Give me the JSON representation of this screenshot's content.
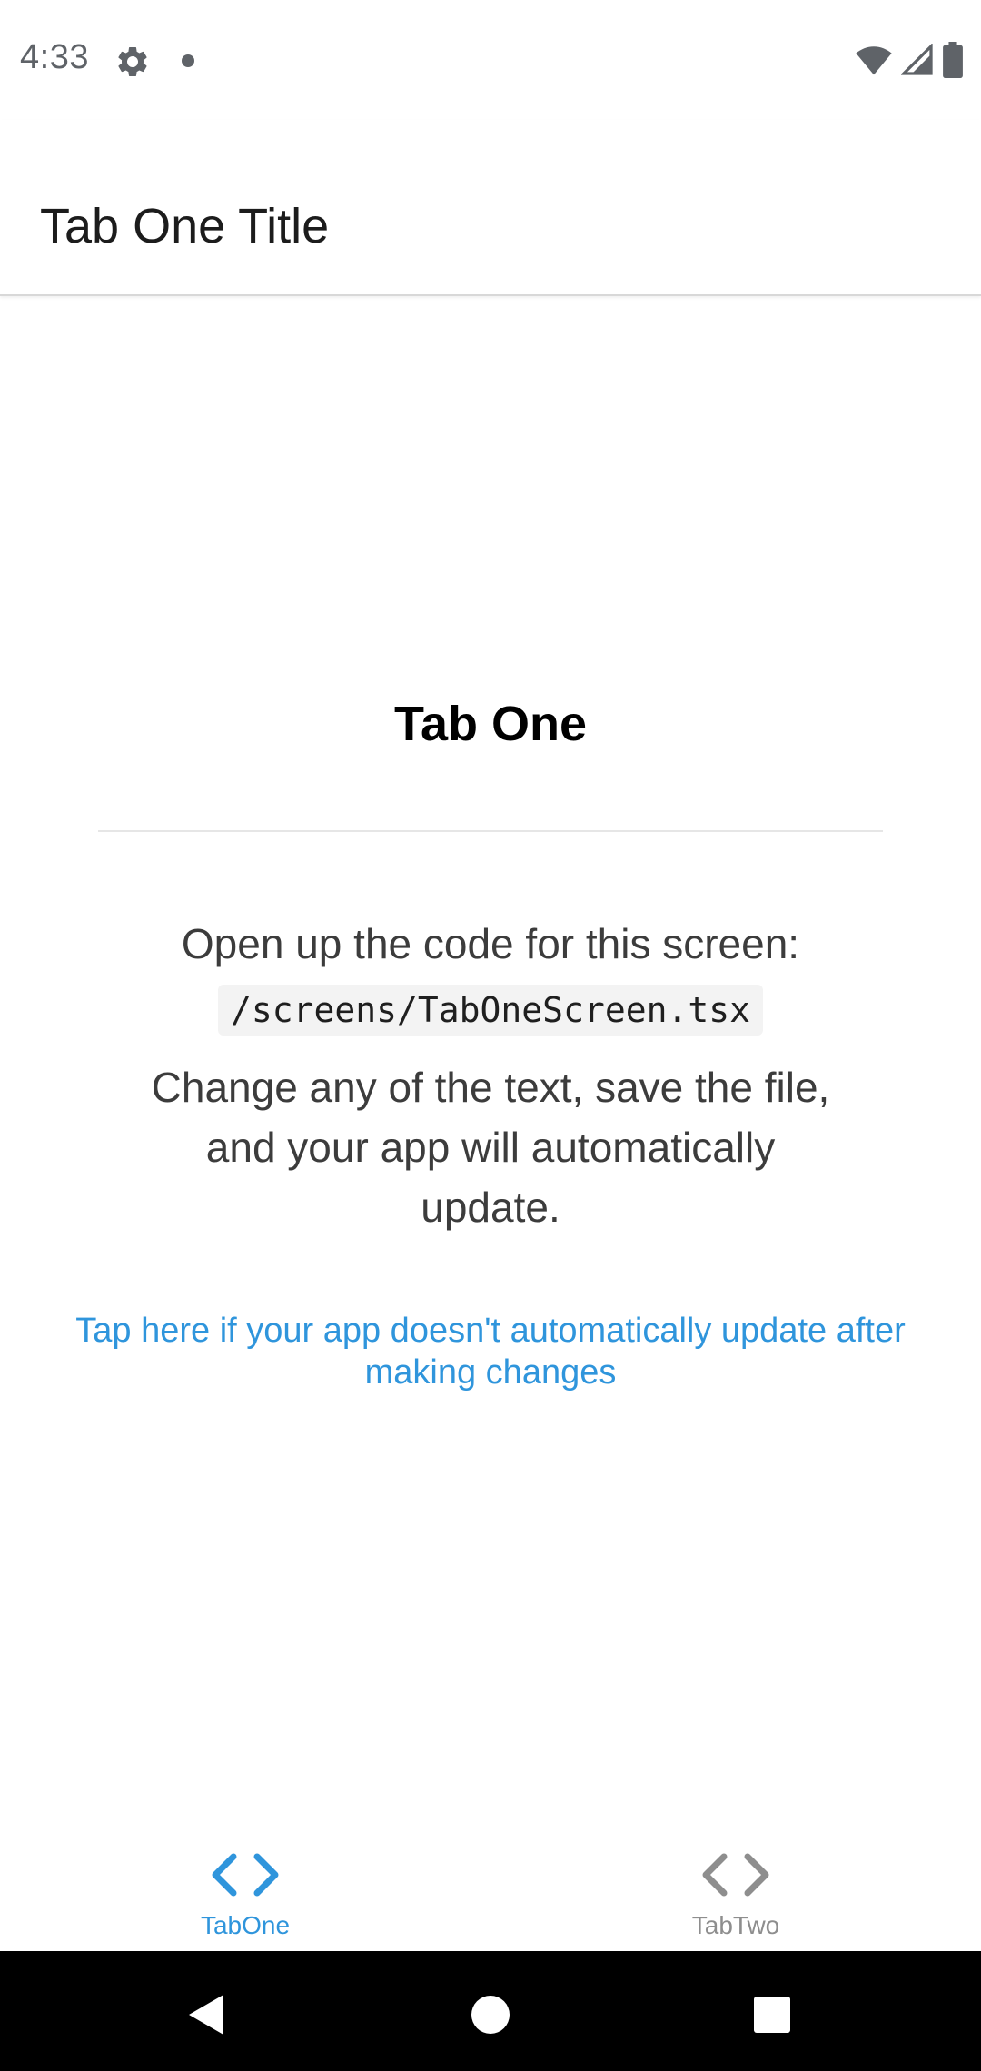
{
  "status_bar": {
    "time": "4:33",
    "icons": [
      "gear-icon",
      "notification-dot-icon",
      "wifi-icon",
      "signal-icon",
      "battery-icon"
    ]
  },
  "header": {
    "title": "Tab One Title"
  },
  "main": {
    "title": "Tab One",
    "instruction": "Open up the code for this screen:",
    "code_path": "/screens/TabOneScreen.tsx",
    "change_text": "Change any of the text, save the file, and your app will automatically update.",
    "help_link": "Tap here if your app doesn't automatically update after making changes"
  },
  "tabs": [
    {
      "label": "TabOne",
      "icon": "code-brackets-icon",
      "active": true
    },
    {
      "label": "TabTwo",
      "icon": "code-brackets-icon",
      "active": false
    }
  ],
  "nav_bar": {
    "buttons": [
      "back-icon",
      "home-icon",
      "recents-icon"
    ]
  },
  "colors": {
    "accent": "#2f95dc",
    "inactive_tab": "#8e8e8e",
    "text": "#3c3c3c",
    "status_icons": "#5f6368"
  }
}
